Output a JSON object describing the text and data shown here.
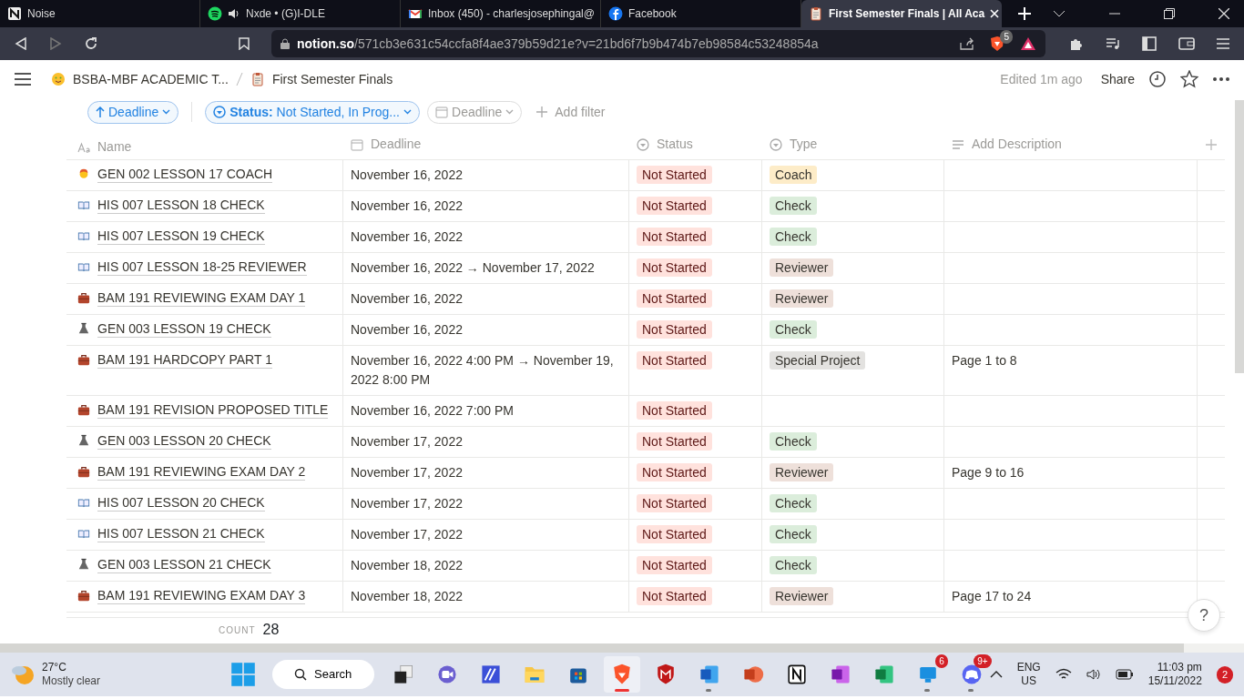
{
  "browser": {
    "tabs": [
      {
        "title": "Noise",
        "kind": "notion",
        "audio": false,
        "selected": false
      },
      {
        "title": "Nxde • (G)I-DLE",
        "kind": "spotify",
        "audio": true,
        "selected": false
      },
      {
        "title": "Inbox (450) - charlesjosephingal@",
        "kind": "gmail",
        "audio": false,
        "selected": false
      },
      {
        "title": "Facebook",
        "kind": "facebook",
        "audio": false,
        "selected": false
      },
      {
        "title": "First Semester Finals | All Aca",
        "kind": "clipboard",
        "audio": false,
        "selected": true
      }
    ],
    "url_host": "notion.so",
    "url_path": "/571cb3e631c54ccfa8f4ae379b59d21e?v=21bd6f7b9b474b7eb98584c53248854a",
    "shields_count": "5"
  },
  "topbar": {
    "breadcrumbs": [
      {
        "kind": "face",
        "label": "BSBA-MBF ACADEMIC T..."
      },
      {
        "kind": "clipboard",
        "label": "First Semester Finals"
      }
    ],
    "edited": "Edited 1m ago",
    "share": "Share"
  },
  "filters": {
    "sort": "Deadline",
    "status_filter": "**Status:** Not Started, In Prog...",
    "date_filter": "Deadline",
    "add_filter": "Add filter"
  },
  "table": {
    "columns": [
      {
        "kind": "text",
        "label": "Name"
      },
      {
        "kind": "calendar",
        "label": "Deadline"
      },
      {
        "kind": "select",
        "label": "Status"
      },
      {
        "kind": "select",
        "label": "Type"
      },
      {
        "kind": "lines",
        "label": "Add Description"
      }
    ],
    "rows": [
      {
        "kind": "person",
        "name": "GEN 002 LESSON 17 COACH",
        "deadline": "November 16, 2022",
        "status": {
          "label": "Not Started",
          "color": "#ffe2dd"
        },
        "type": {
          "label": "Coach",
          "color": "#fdecc8"
        }
      },
      {
        "kind": "book",
        "name": "HIS 007 LESSON 18 CHECK",
        "deadline": "November 16, 2022",
        "status": {
          "label": "Not Started",
          "color": "#ffe2dd"
        },
        "type": {
          "label": "Check",
          "color": "#dbeddb"
        }
      },
      {
        "kind": "book",
        "name": "HIS 007 LESSON 19 CHECK",
        "deadline": "November 16, 2022",
        "status": {
          "label": "Not Started",
          "color": "#ffe2dd"
        },
        "type": {
          "label": "Check",
          "color": "#dbeddb"
        }
      },
      {
        "kind": "book",
        "name": "HIS 007 LESSON 18-25 REVIEWER",
        "deadline": "November 16, 2022 → November 17, 2022",
        "status": {
          "label": "Not Started",
          "color": "#ffe2dd"
        },
        "type": {
          "label": "Reviewer",
          "color": "#eee0da"
        }
      },
      {
        "kind": "briefcase",
        "name": "BAM 191 REVIEWING EXAM DAY 1",
        "deadline": "November 16, 2022",
        "status": {
          "label": "Not Started",
          "color": "#ffe2dd"
        },
        "type": {
          "label": "Reviewer",
          "color": "#eee0da"
        }
      },
      {
        "kind": "flask",
        "name": "GEN 003 LESSON 19 CHECK",
        "deadline": "November 16, 2022",
        "status": {
          "label": "Not Started",
          "color": "#ffe2dd"
        },
        "type": {
          "label": "Check",
          "color": "#dbeddb"
        }
      },
      {
        "kind": "briefcase",
        "name": "BAM 191 HARDCOPY PART 1",
        "deadline": "November 16, 2022 4:00 PM → November 19, 2022 8:00 PM",
        "status": {
          "label": "Not Started",
          "color": "#ffe2dd"
        },
        "type": {
          "label": "Special Project",
          "color": "#e3e2e0"
        },
        "description": "Page 1 to 8"
      },
      {
        "kind": "briefcase",
        "name": "BAM 191 REVISION PROPOSED TITLE",
        "deadline": "November 16, 2022 7:00 PM",
        "status": {
          "label": "Not Started",
          "color": "#ffe2dd"
        }
      },
      {
        "kind": "flask",
        "name": "GEN 003 LESSON 20 CHECK",
        "deadline": "November 17, 2022",
        "status": {
          "label": "Not Started",
          "color": "#ffe2dd"
        },
        "type": {
          "label": "Check",
          "color": "#dbeddb"
        }
      },
      {
        "kind": "briefcase",
        "name": "BAM 191 REVIEWING EXAM DAY 2",
        "deadline": "November 17, 2022",
        "status": {
          "label": "Not Started",
          "color": "#ffe2dd"
        },
        "type": {
          "label": "Reviewer",
          "color": "#eee0da"
        },
        "description": "Page 9 to 16"
      },
      {
        "kind": "book",
        "name": "HIS 007 LESSON 20 CHECK",
        "deadline": "November 17, 2022",
        "status": {
          "label": "Not Started",
          "color": "#ffe2dd"
        },
        "type": {
          "label": "Check",
          "color": "#dbeddb"
        }
      },
      {
        "kind": "book",
        "name": "HIS 007 LESSON 21 CHECK",
        "deadline": "November 17, 2022",
        "status": {
          "label": "Not Started",
          "color": "#ffe2dd"
        },
        "type": {
          "label": "Check",
          "color": "#dbeddb"
        }
      },
      {
        "kind": "flask",
        "name": "GEN 003 LESSON 21 CHECK",
        "deadline": "November 18, 2022",
        "status": {
          "label": "Not Started",
          "color": "#ffe2dd"
        },
        "type": {
          "label": "Check",
          "color": "#dbeddb"
        }
      },
      {
        "kind": "briefcase",
        "name": "BAM 191 REVIEWING EXAM DAY 3",
        "deadline": "November 18, 2022",
        "status": {
          "label": "Not Started",
          "color": "#ffe2dd"
        },
        "type": {
          "label": "Reviewer",
          "color": "#eee0da"
        },
        "description": "Page 17 to 24"
      }
    ],
    "count_label": "COUNT",
    "count": "28"
  },
  "help": "?",
  "taskbar": {
    "weather": {
      "temp": "27°C",
      "condition": "Mostly clear"
    },
    "search": "Search",
    "apps": [
      {
        "kind": "start",
        "running": false,
        "selected": false
      },
      {
        "kind": "taskview",
        "running": false,
        "selected": false
      },
      {
        "kind": "meet",
        "running": false,
        "selected": false
      },
      {
        "kind": "editor",
        "running": false,
        "selected": false
      },
      {
        "kind": "folder",
        "running": false,
        "selected": false
      },
      {
        "kind": "store",
        "running": false,
        "selected": false
      },
      {
        "kind": "lion",
        "running": true,
        "selected": true
      },
      {
        "kind": "shield",
        "running": false,
        "selected": false
      },
      {
        "kind": "word",
        "running": true,
        "selected": false
      },
      {
        "kind": "slides",
        "running": false,
        "selected": false
      },
      {
        "kind": "notion",
        "running": false,
        "selected": false
      },
      {
        "kind": "notebook",
        "running": false,
        "selected": false
      },
      {
        "kind": "sheet",
        "running": false,
        "selected": false
      },
      {
        "kind": "monitor",
        "running": true,
        "selected": false,
        "badge": "6"
      },
      {
        "kind": "chat",
        "running": true,
        "selected": false,
        "badge": "9+"
      }
    ],
    "lang": "ENG",
    "region": "US",
    "time": "11:03 pm",
    "date": "15/11/2022",
    "notifications": "2"
  }
}
